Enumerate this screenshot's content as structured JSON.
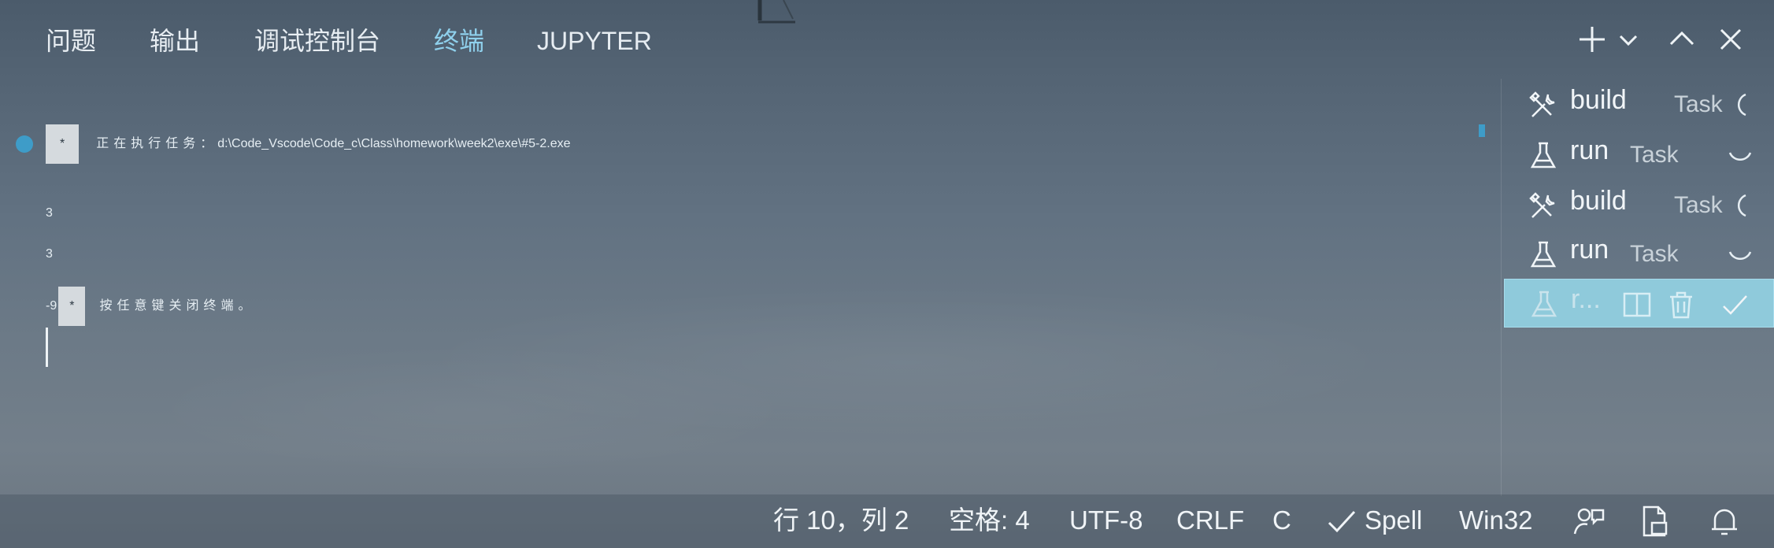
{
  "tabs": [
    {
      "label": "问题",
      "active": false
    },
    {
      "label": "输出",
      "active": false
    },
    {
      "label": "调试控制台",
      "active": false
    },
    {
      "label": "终端",
      "active": true
    },
    {
      "label": "JUPYTER",
      "active": false
    }
  ],
  "toolbar_icons": [
    "plus-icon",
    "chevron-down-icon",
    "chevron-up-icon",
    "close-icon"
  ],
  "terminal": {
    "exec_badge": "*",
    "exec_text": "正在执行任务：",
    "exec_path": "d:\\Code_Vscode\\Code_c\\Class\\homework\\week2\\exe\\#5-2.exe",
    "output_lines": [
      "3",
      "3",
      "-9"
    ],
    "end_badge": "*",
    "end_text": "按任意键关闭终端。"
  },
  "tasks": [
    {
      "name": "build",
      "kind": "Task",
      "icon": "tools-icon"
    },
    {
      "name": "run",
      "kind": "Task",
      "icon": "beaker-icon"
    },
    {
      "name": "build",
      "kind": "Task",
      "icon": "tools-icon"
    },
    {
      "name": "run",
      "kind": "Task",
      "icon": "beaker-icon"
    },
    {
      "name": "r...",
      "kind": "",
      "icon": "beaker-icon",
      "selected": true
    }
  ],
  "status_bar": {
    "position": "行 10，列 2",
    "spaces": "空格: 4",
    "encoding": "UTF-8",
    "eol": "CRLF",
    "language": "C",
    "spell": "Spell",
    "platform": "Win32"
  },
  "colors": {
    "accent": "#8fd0ec",
    "selected_task_bg": "#8fcadb",
    "dot": "#3e9cc8"
  }
}
